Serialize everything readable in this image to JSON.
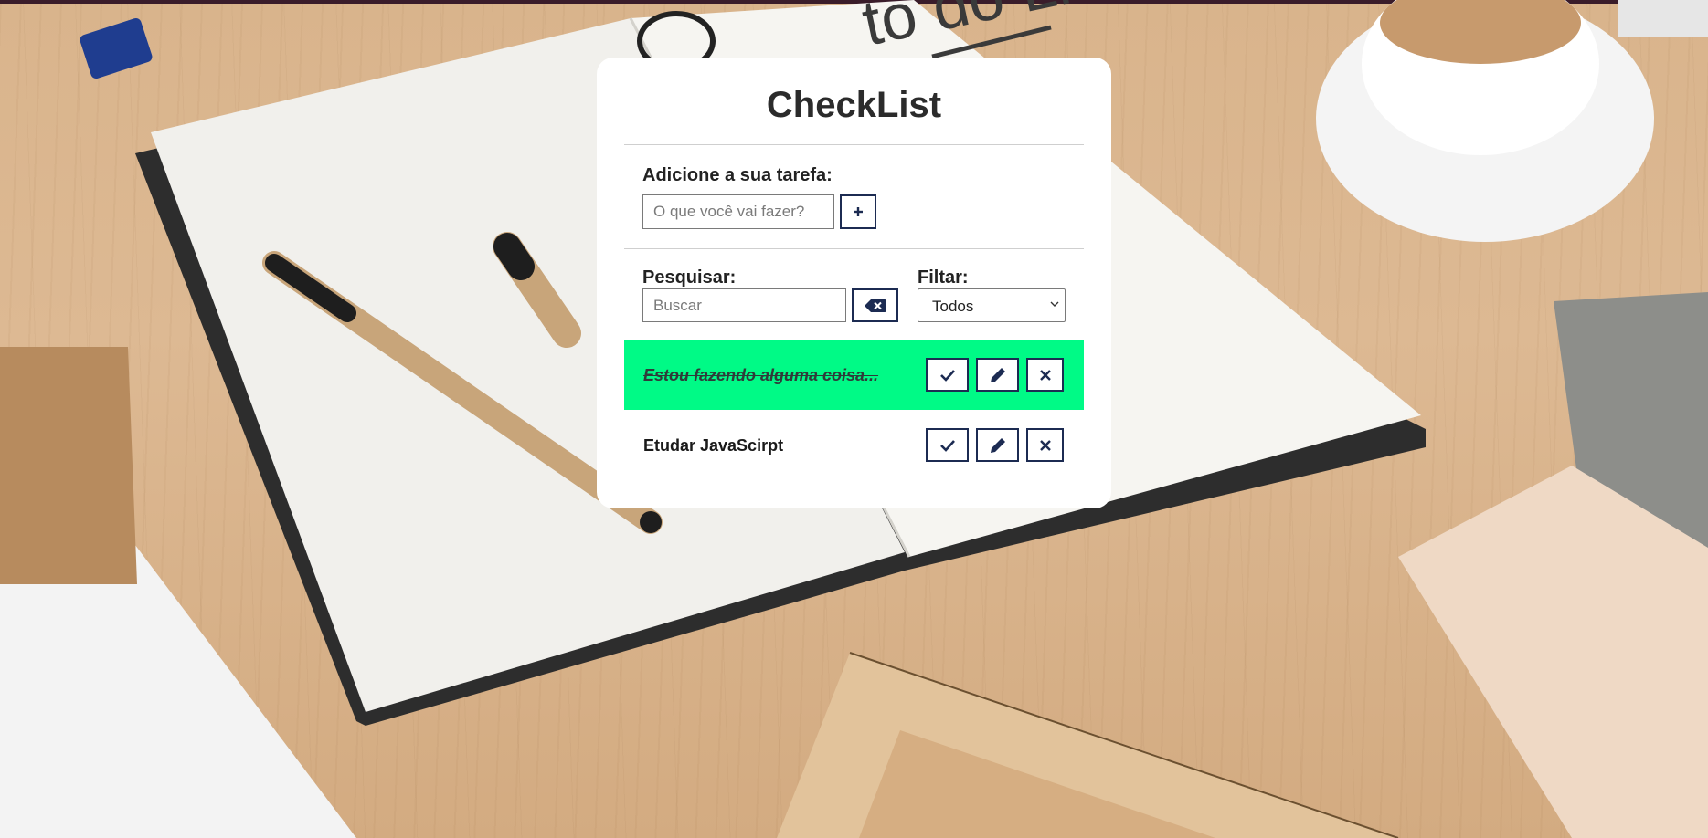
{
  "app": {
    "title": "CheckList"
  },
  "add_section": {
    "label": "Adicione a sua tarefa:",
    "placeholder": "O que você vai fazer?",
    "add_button_icon": "plus-icon"
  },
  "search_section": {
    "label": "Pesquisar:",
    "placeholder": "Buscar",
    "clear_button_icon": "backspace-icon"
  },
  "filter_section": {
    "label": "Filtar:",
    "selected": "Todos"
  },
  "tasks": [
    {
      "text": "Estou fazendo alguma coisa...",
      "done": true
    },
    {
      "text": "Etudar JavaScirpt",
      "done": false
    }
  ],
  "task_action_icons": [
    "check-icon",
    "pencil-icon",
    "close-icon"
  ],
  "colors": {
    "accent_dark": "#1c2b52",
    "done_row": "#00fa86",
    "panel": "#ffffff"
  }
}
